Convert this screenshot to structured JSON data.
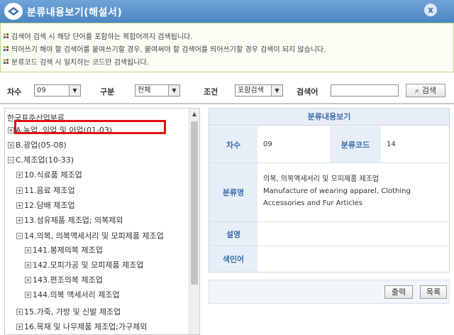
{
  "window": {
    "title": "분류내용보기(해설서)",
    "close_label": "x"
  },
  "notes": [
    "검색어 검색 시 해당 단어를 포함하는 복합어까지 검색됩니다.",
    "띄어쓰기 해야 할 검색어를 붙여쓰기할 경우, 붙여써야 할 검색어를 띄어쓰기할 경우 검색이 되지 않습니다.",
    "분류코드 검색 시 일치하는 코드만 검색됩니다."
  ],
  "search": {
    "chasu_label": "차수",
    "chasu_value": "09",
    "gubun_label": "구분",
    "gubun_value": "전체",
    "condition_label": "조건",
    "condition_value": "포함검색",
    "keyword_label": "검색어",
    "keyword_value": "",
    "search_button": "검색"
  },
  "tree": {
    "root": "한국표준산업분류",
    "nodes": [
      {
        "label": "A.농업, 임업 및 어업(01-03)",
        "expander": "+"
      },
      {
        "label": "B.광업(05-08)",
        "expander": "+"
      },
      {
        "label": "C.제조업(10-33)",
        "expander": "−"
      },
      {
        "label": "10.식료품 제조업",
        "expander": "+"
      },
      {
        "label": "11.음료 제조업",
        "expander": "+"
      },
      {
        "label": "12.담배 제조업",
        "expander": "+"
      },
      {
        "label": "13.섬유제품 제조업; 의복제외",
        "expander": "+"
      },
      {
        "label": "14.의복, 의복액세서리 및 모피제품 제조업",
        "expander": "−"
      },
      {
        "label": "141.봉제의복 제조업",
        "expander": "+"
      },
      {
        "label": "142.모피가공 및 모피제품 제조업",
        "expander": "+"
      },
      {
        "label": "143.편조의복 제조업",
        "expander": "+"
      },
      {
        "label": "144.의복 액세서리 제조업",
        "expander": "+"
      },
      {
        "label": "15.가죽, 가방 및 신발 제조업",
        "expander": "+"
      },
      {
        "label": "16.목재 및 나무제품 제조업;가구제외",
        "expander": "+"
      }
    ]
  },
  "detail": {
    "header": "분류내용보기",
    "chasu_label": "차수",
    "chasu_value": "09",
    "code_label": "분류코드",
    "code_value": "14",
    "name_label": "분류명",
    "name_ko": "의복, 의복액세서리 및 모피제품 제조업",
    "name_en_1": "Manufacture of wearing apparel, Clothing",
    "name_en_2": "Accessories and Fur Articles",
    "desc_label": "설명",
    "desc_value": "",
    "index_label": "색인어",
    "index_value": ""
  },
  "actions": {
    "print": "출력",
    "list": "목록"
  },
  "colors": {
    "titlebar": "#4a86c4",
    "accent": "#3a6fa8",
    "highlight": "#e01010"
  }
}
